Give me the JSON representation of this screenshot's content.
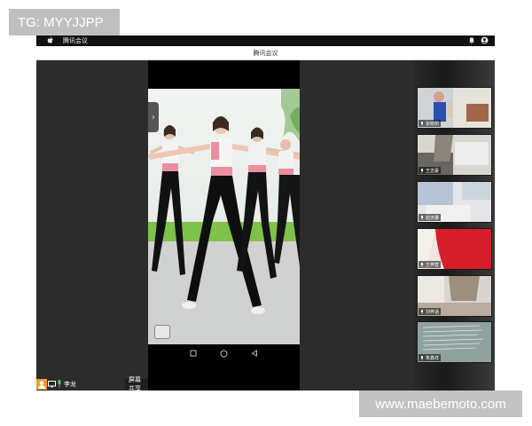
{
  "watermarks": {
    "top_left": "TG: MYYJJPP",
    "bottom_right": "www.maebemoto.com"
  },
  "menubar": {
    "app_name": "腾讯会议",
    "icons": [
      "apple-icon",
      "notification-icon",
      "user-icon"
    ]
  },
  "window": {
    "title": "腾讯会议"
  },
  "participants": [
    {
      "name": "张晓阳",
      "muted": false
    },
    {
      "name": "王志豪",
      "muted": false
    },
    {
      "name": "赵天娜",
      "muted": false
    },
    {
      "name": "王梓萱",
      "muted": false
    },
    {
      "name": "刘梓涵",
      "muted": false
    },
    {
      "name": "朱鑫祥",
      "muted": false
    }
  ],
  "bottombar": {
    "self_name": "李龙",
    "share_label": "屏幕共享"
  },
  "colors": {
    "app_dark": "#2c2c2d",
    "accent_orange": "#f39a2c"
  }
}
